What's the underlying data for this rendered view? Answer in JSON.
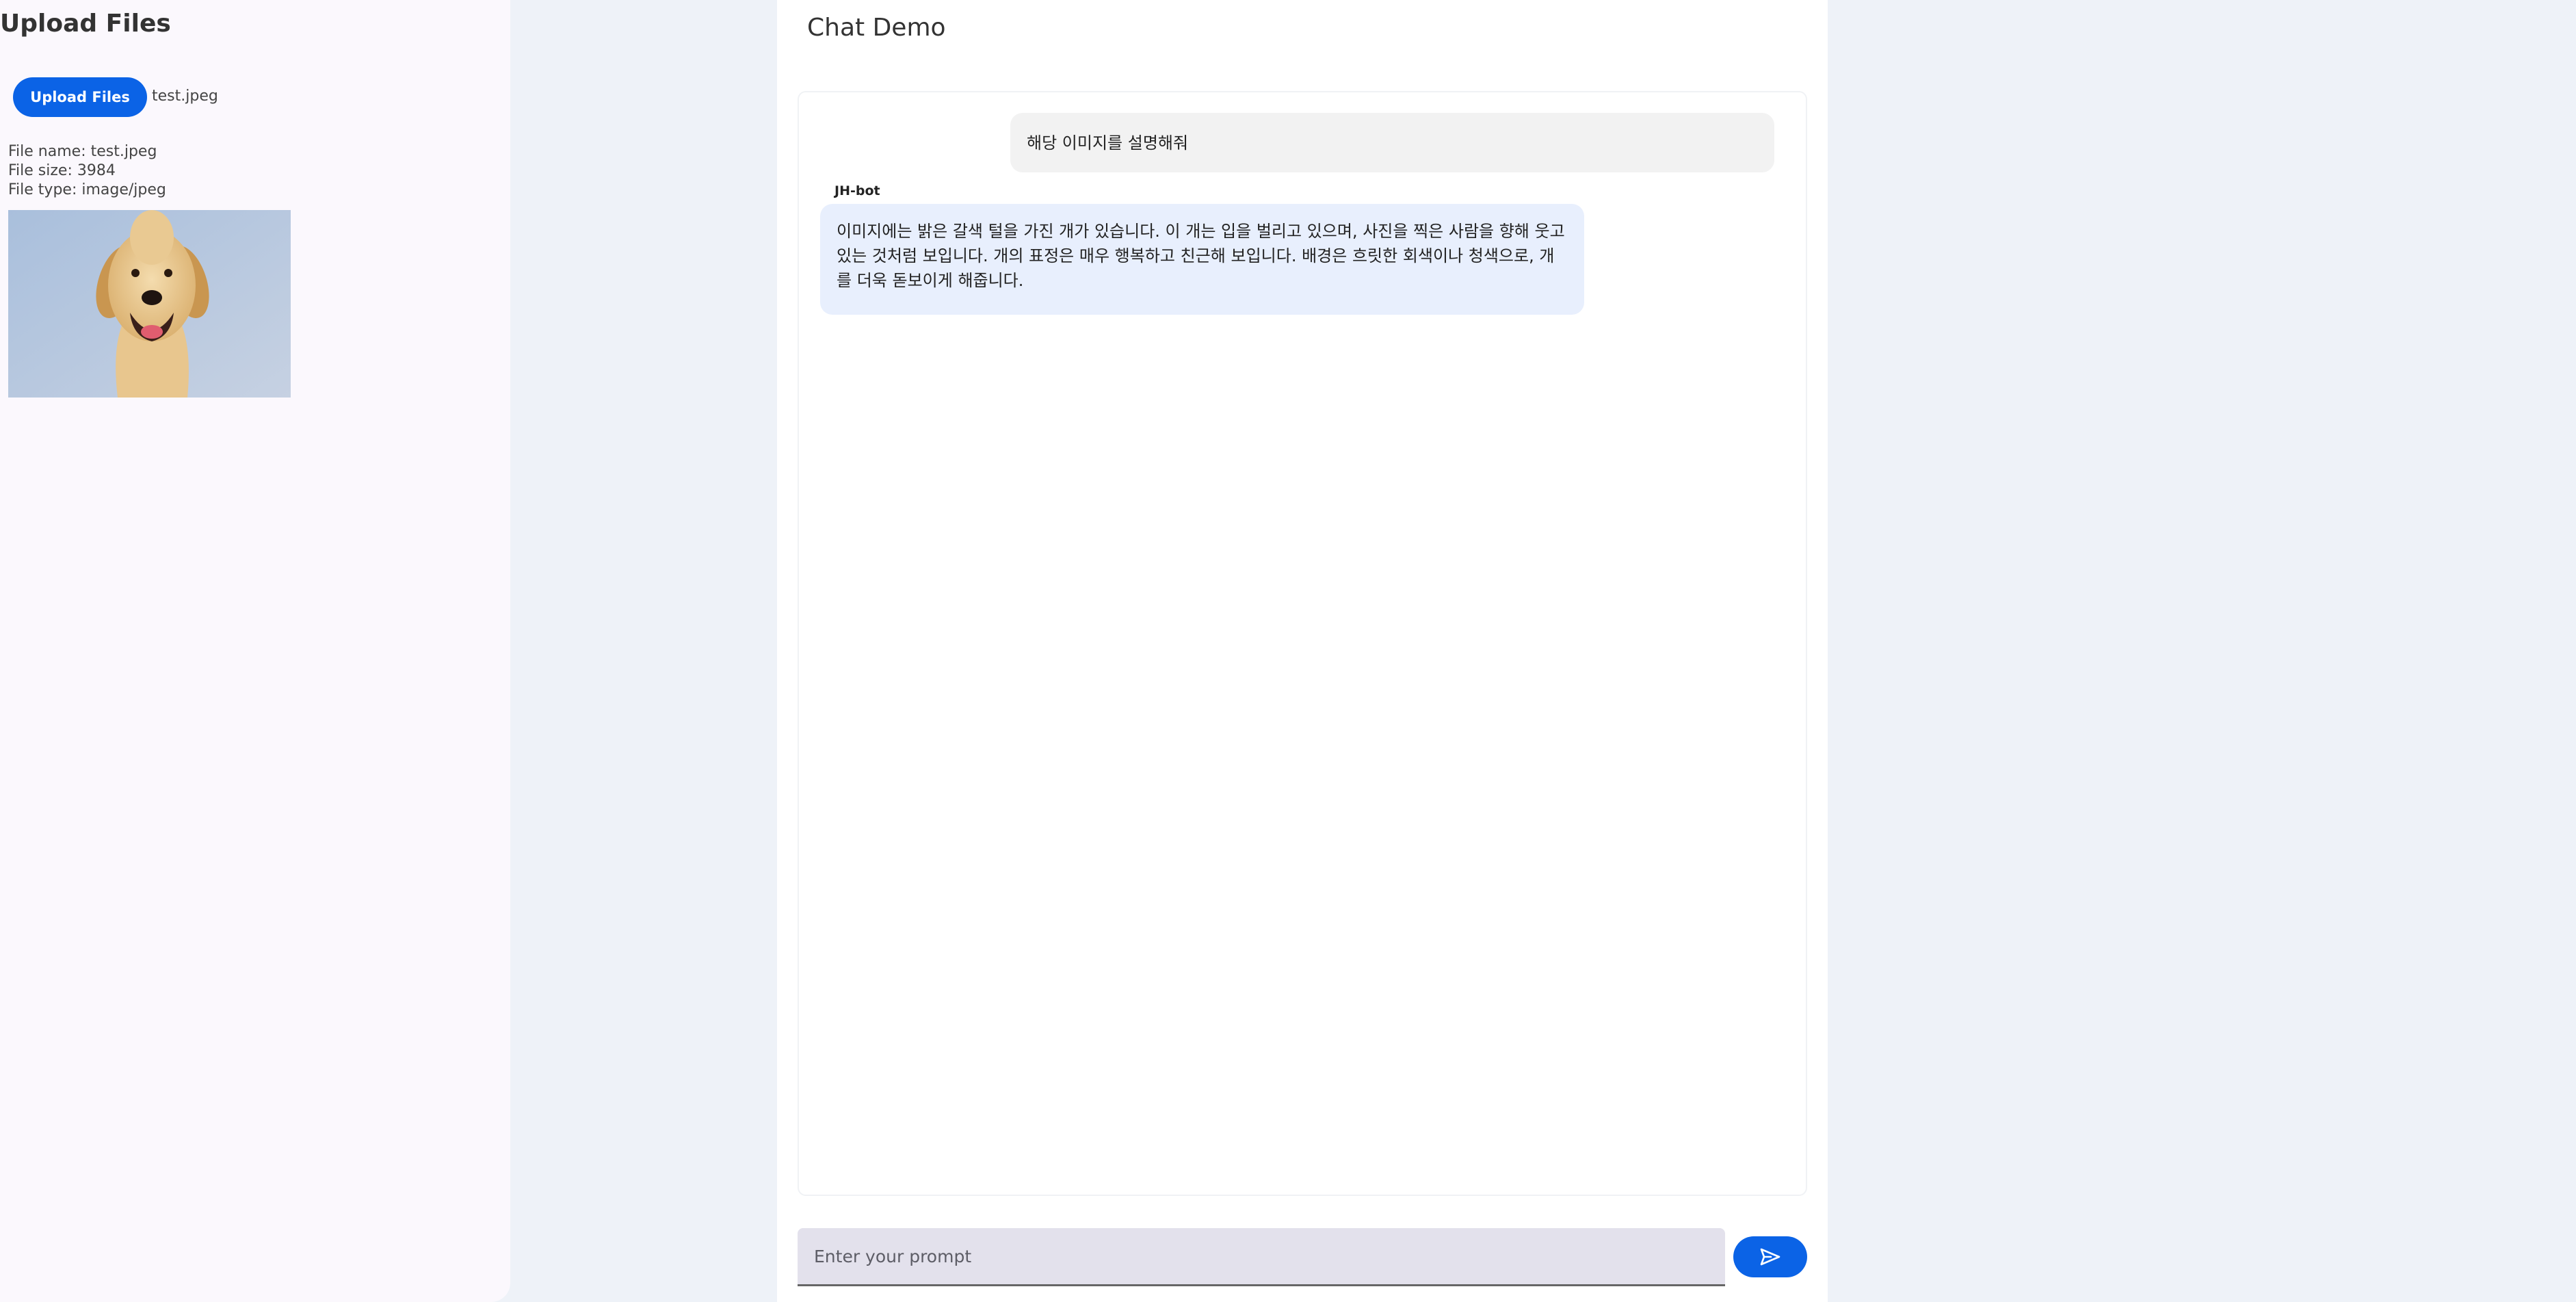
{
  "sidebar": {
    "title": "Upload Files",
    "upload_button_label": "Upload Files",
    "selected_file": "test.jpeg",
    "file_info": {
      "name": "File name: test.jpeg",
      "size": "File size: 3984",
      "type": "File type: image/jpeg"
    }
  },
  "main": {
    "title": "Chat Demo",
    "messages": [
      {
        "role": "user",
        "text": "해당 이미지를 설명해줘"
      },
      {
        "role": "bot",
        "sender": "JH-bot",
        "text": "이미지에는 밝은 갈색 털을 가진 개가 있습니다. 이 개는 입을 벌리고 있으며, 사진을 찍은 사람을 향해 웃고 있는 것처럼 보입니다. 개의 표정은 매우 행복하고 친근해 보입니다. 배경은 흐릿한 회색이나 청색으로, 개를 더욱 돋보이게 해줍니다."
      }
    ],
    "prompt_placeholder": "Enter your prompt",
    "send_icon": "send-icon"
  },
  "colors": {
    "accent": "#0b63e6",
    "user_bubble": "#f2f2f2",
    "bot_bubble": "#e8effd",
    "input_bg": "#e3e1ec"
  }
}
